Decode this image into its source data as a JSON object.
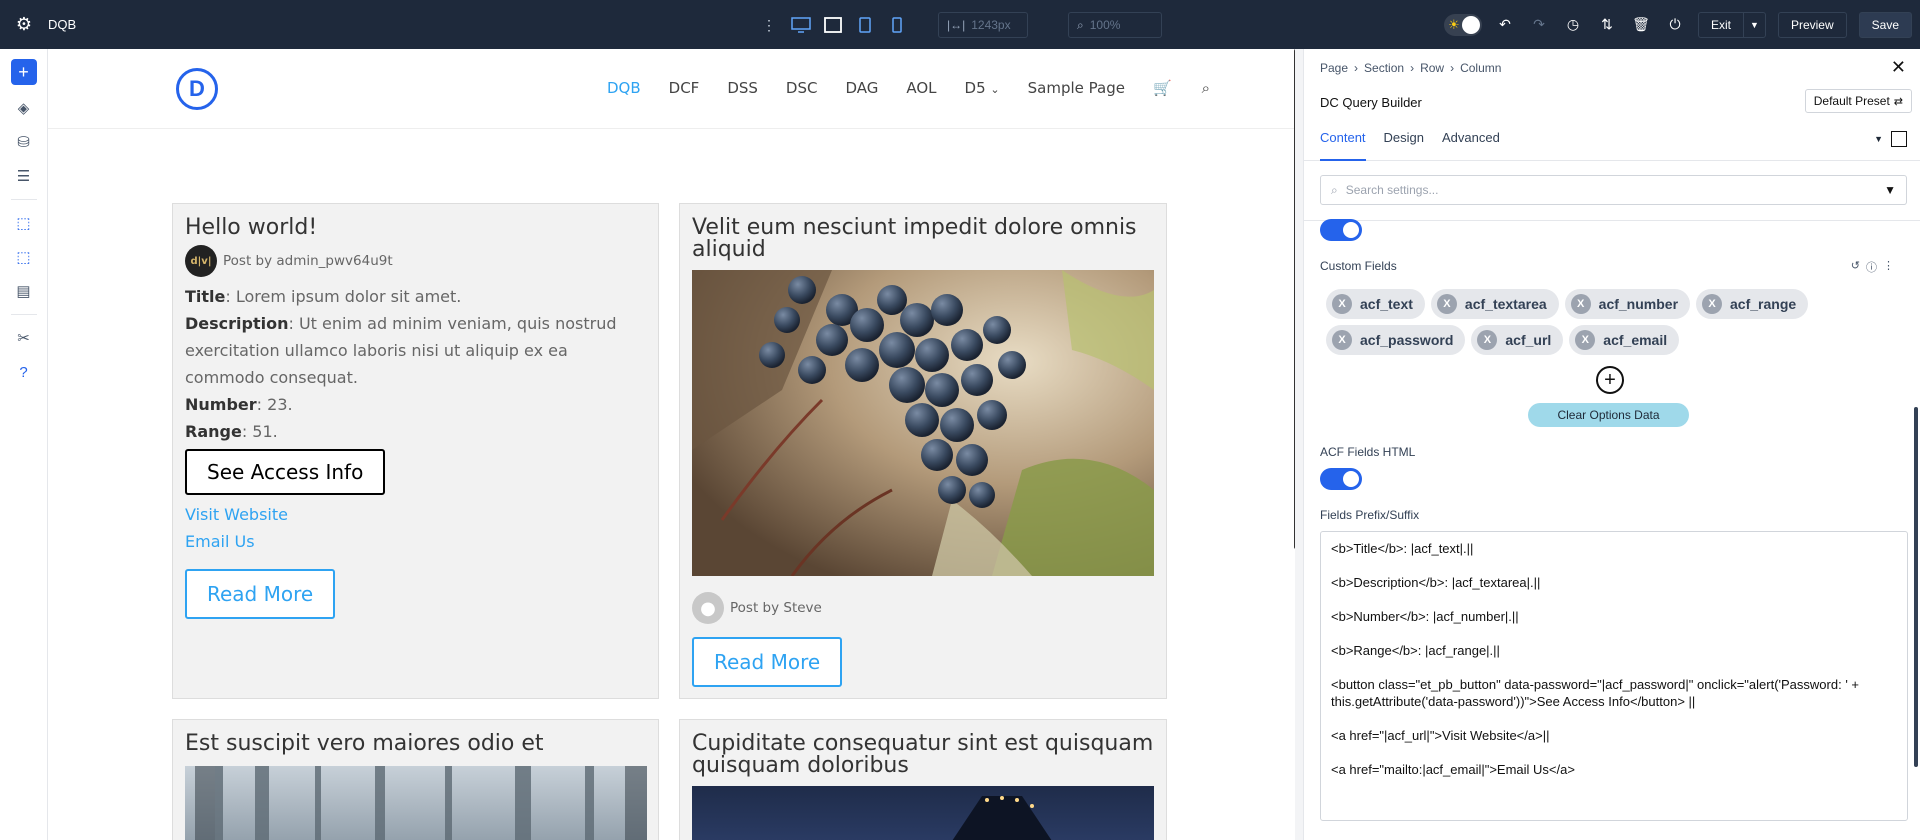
{
  "topbar": {
    "app_title": "DQB",
    "width_value": "1243px",
    "zoom_value": "100%",
    "exit_label": "Exit",
    "preview_label": "Preview",
    "save_label": "Save"
  },
  "site": {
    "logo_letter": "D",
    "nav": [
      "DQB",
      "DCF",
      "DSS",
      "DSC",
      "DAG",
      "AOL",
      "D5",
      "Sample Page"
    ],
    "nav_active": "DQB"
  },
  "posts": [
    {
      "title": "Hello world!",
      "author": "Post by admin_pwv64u9t",
      "avatar_text": "d|v|",
      "fields": {
        "title_label": "Title",
        "title_value": ": Lorem ipsum dolor sit amet.",
        "desc_label": "Description",
        "desc_value": ": Ut enim ad minim veniam, quis nostrud exercitation ullamco laboris nisi ut aliquip ex ea commodo consequat.",
        "number_label": "Number",
        "number_value": ": 23.",
        "range_label": "Range",
        "range_value": ": 51."
      },
      "access_button": "See Access Info",
      "visit_link": "Visit Website",
      "email_link": "Email Us",
      "read_more": "Read More"
    },
    {
      "title": "Velit eum nesciunt impedit dolore omnis aliquid",
      "author": "Post by Steve",
      "read_more": "Read More"
    },
    {
      "title": "Est suscipit vero maiores odio et"
    },
    {
      "title": "Cupiditate consequatur sint est quisquam quisquam doloribus"
    }
  ],
  "panel": {
    "breadcrumb": [
      "Page",
      "Section",
      "Row",
      "Column"
    ],
    "module_name": "DC Query Builder",
    "preset": "Default Preset",
    "tabs": [
      "Content",
      "Design",
      "Advanced"
    ],
    "search_placeholder": "Search settings...",
    "custom_fields_label": "Custom Fields",
    "chips": [
      "acf_text",
      "acf_textarea",
      "acf_number",
      "acf_range",
      "acf_password",
      "acf_url",
      "acf_email"
    ],
    "clear_button": "Clear Options Data",
    "acf_html_label": "ACF Fields HTML",
    "prefix_label": "Fields Prefix/Suffix",
    "code_lines": [
      "<b>Title</b>: |acf_text|.||",
      "<b>Description</b>: |acf_textarea|.||",
      "<b>Number</b>: |acf_number|.||",
      "<b>Range</b>: |acf_range|.||",
      "<button class=\"et_pb_button\" data-password=\"|acf_password|\" onclick=\"alert('Password: ' + this.getAttribute('data-password'))\">See Access Info</button> ||",
      "<a href=\"|acf_url|\">Visit Website</a>||",
      "<a href=\"mailto:|acf_email|\">Email Us</a>"
    ]
  },
  "colors": {
    "accent": "#2563eb",
    "link": "#2ea3f2",
    "topbar": "#1e293b"
  }
}
